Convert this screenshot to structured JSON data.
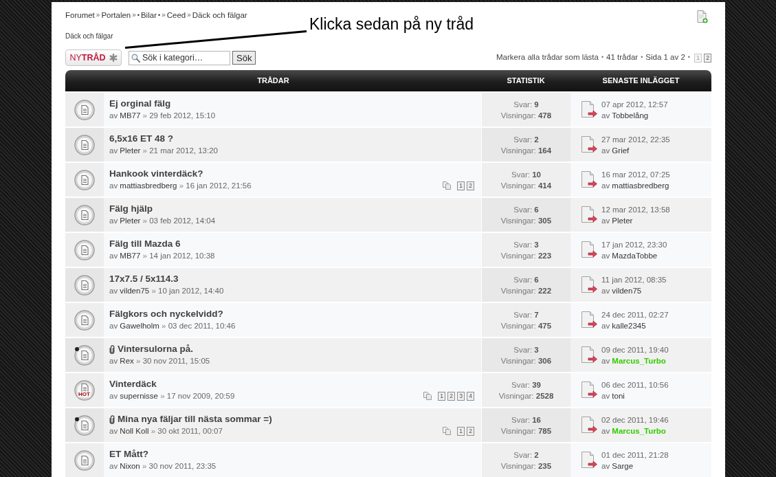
{
  "breadcrumb": [
    {
      "text": "Forumet",
      "kind": "link"
    },
    {
      "text": "»",
      "kind": "separator"
    },
    {
      "text": "Portalen",
      "kind": "link"
    },
    {
      "text": "»",
      "kind": "separator"
    },
    {
      "text": "•",
      "kind": "bullet"
    },
    {
      "text": "Bilar",
      "kind": "link"
    },
    {
      "text": "•",
      "kind": "bullet"
    },
    {
      "text": "»",
      "kind": "separator"
    },
    {
      "text": "Ceed",
      "kind": "link"
    },
    {
      "text": "»",
      "kind": "separator"
    },
    {
      "text": "Däck och fälgar",
      "kind": "link"
    }
  ],
  "forum_title": "Däck och fälgar",
  "annotation": "Klicka sedan på ny tråd",
  "toolbar": {
    "new_topic": "NY**TRÅD**",
    "search": {
      "placeholder": "Sök i kategori…",
      "button": "Sök"
    },
    "info": [
      {
        "text": "Markera alla trådar som lästa",
        "kind": "link"
      },
      {
        "text": "•",
        "kind": "separator"
      },
      {
        "text": "41 trådar",
        "kind": "text"
      },
      {
        "text": "•",
        "kind": "separator"
      },
      {
        "text": "Sida 1 av 2",
        "kind": "text"
      },
      {
        "text": "•",
        "kind": "separator"
      }
    ],
    "pagination": [
      {
        "label": "1",
        "selected": true
      },
      {
        "label": "2",
        "selected": false
      }
    ]
  },
  "table": {
    "columns": [
      "TRÅDAR",
      "STATISTIK",
      "SENASTE INLÄGGET"
    ],
    "rows": [
      {
        "title": "Ej orginal fälg",
        "attachment": false,
        "posted": false,
        "started": {
          "prefix": "av",
          "author": "MB77",
          "separator": "»",
          "date": "29 feb 2012, 15:10"
        },
        "stats": {
          "replies_label": "Svar:",
          "replies": "9",
          "views_label": "Visningar:",
          "views": "478"
        },
        "last_post": {
          "date": "07 apr 2012, 12:57",
          "prefix": "av",
          "author": "Tobbelång",
          "color": "#333333",
          "bold": false
        }
      },
      {
        "title": "6,5x16 ET 48 ?",
        "attachment": false,
        "posted": false,
        "started": {
          "prefix": "av",
          "author": "Pleter",
          "separator": "»",
          "date": "21 mar 2012, 13:20"
        },
        "stats": {
          "replies_label": "Svar:",
          "replies": "2",
          "views_label": "Visningar:",
          "views": "164"
        },
        "last_post": {
          "date": "27 mar 2012, 22:35",
          "prefix": "av",
          "author": "Grief",
          "color": "#333333",
          "bold": false
        }
      },
      {
        "title": "Hankook vinterdäck?",
        "attachment": false,
        "posted": false,
        "started": {
          "prefix": "av",
          "author": "mattiasbredberg",
          "separator": "»",
          "date": "16 jan 2012, 21:56"
        },
        "pages": [
          "1",
          "2"
        ],
        "stats": {
          "replies_label": "Svar:",
          "replies": "10",
          "views_label": "Visningar:",
          "views": "414"
        },
        "last_post": {
          "date": "16 mar 2012, 07:25",
          "prefix": "av",
          "author": "mattiasbredberg",
          "color": "#333333",
          "bold": false
        }
      },
      {
        "title": "Fälg hjälp",
        "attachment": false,
        "posted": false,
        "started": {
          "prefix": "av",
          "author": "Pleter",
          "separator": "»",
          "date": "03 feb 2012, 14:04"
        },
        "stats": {
          "replies_label": "Svar:",
          "replies": "6",
          "views_label": "Visningar:",
          "views": "305"
        },
        "last_post": {
          "date": "12 mar 2012, 13:58",
          "prefix": "av",
          "author": "Pleter",
          "color": "#333333",
          "bold": false
        }
      },
      {
        "title": "Fälg till Mazda 6",
        "attachment": false,
        "posted": false,
        "started": {
          "prefix": "av",
          "author": "MB77",
          "separator": "»",
          "date": "14 jan 2012, 10:38"
        },
        "stats": {
          "replies_label": "Svar:",
          "replies": "3",
          "views_label": "Visningar:",
          "views": "223"
        },
        "last_post": {
          "date": "17 jan 2012, 23:30",
          "prefix": "av",
          "author": "MazdaTobbe",
          "color": "#333333",
          "bold": false
        }
      },
      {
        "title": "17x7.5 / 5x114.3",
        "attachment": false,
        "posted": false,
        "started": {
          "prefix": "av",
          "author": "vilden75",
          "separator": "»",
          "date": "10 jan 2012, 14:40"
        },
        "stats": {
          "replies_label": "Svar:",
          "replies": "6",
          "views_label": "Visningar:",
          "views": "222"
        },
        "last_post": {
          "date": "11 jan 2012, 08:35",
          "prefix": "av",
          "author": "vilden75",
          "color": "#333333",
          "bold": false
        }
      },
      {
        "title": "Fälgkors och nyckelvidd?",
        "attachment": false,
        "posted": false,
        "started": {
          "prefix": "av",
          "author": "Gawelholm",
          "separator": "»",
          "date": "03 dec 2011, 10:46"
        },
        "stats": {
          "replies_label": "Svar:",
          "replies": "7",
          "views_label": "Visningar:",
          "views": "475"
        },
        "last_post": {
          "date": "24 dec 2011, 02:27",
          "prefix": "av",
          "author": "kalle2345",
          "color": "#333333",
          "bold": false
        }
      },
      {
        "title": "Vintersulorna på.",
        "attachment": true,
        "posted": true,
        "started": {
          "prefix": "av",
          "author": "Rex",
          "separator": "»",
          "date": "30 nov 2011, 15:05"
        },
        "stats": {
          "replies_label": "Svar:",
          "replies": "3",
          "views_label": "Visningar:",
          "views": "306"
        },
        "last_post": {
          "date": "09 dec 2011, 19:40",
          "prefix": "av",
          "author": "Marcus_Turbo",
          "color": "#33cc00",
          "bold": true
        }
      },
      {
        "title": "Vinterdäck",
        "attachment": false,
        "posted": false,
        "badge": "HOT",
        "started": {
          "prefix": "av",
          "author": "supernisse",
          "separator": "»",
          "date": "17 nov 2009, 20:59"
        },
        "pages": [
          "1",
          "2",
          "3",
          "4"
        ],
        "stats": {
          "replies_label": "Svar:",
          "replies": "39",
          "views_label": "Visningar:",
          "views": "2528"
        },
        "last_post": {
          "date": "06 dec 2011, 10:56",
          "prefix": "av",
          "author": "toni",
          "color": "#333333",
          "bold": false
        }
      },
      {
        "title": "Mina nya fäljar till nästa sommar =)",
        "attachment": true,
        "posted": true,
        "started": {
          "prefix": "av",
          "author": "Noll Koll",
          "separator": "»",
          "date": "30 okt 2011, 00:07"
        },
        "pages": [
          "1",
          "2"
        ],
        "stats": {
          "replies_label": "Svar:",
          "replies": "16",
          "views_label": "Visningar:",
          "views": "785"
        },
        "last_post": {
          "date": "02 dec 2011, 19:46",
          "prefix": "av",
          "author": "Marcus_Turbo",
          "color": "#33cc00",
          "bold": true
        }
      },
      {
        "title": "ET Mått?",
        "attachment": false,
        "posted": false,
        "started": {
          "prefix": "av",
          "author": "Nixon",
          "separator": "»",
          "date": "30 nov 2011, 23:35"
        },
        "stats": {
          "replies_label": "Svar:",
          "replies": "2",
          "views_label": "Visningar:",
          "views": "235"
        },
        "last_post": {
          "date": "01 dec 2011, 21:28",
          "prefix": "av",
          "author": "Sarge",
          "color": "#333333",
          "bold": false
        }
      }
    ]
  }
}
